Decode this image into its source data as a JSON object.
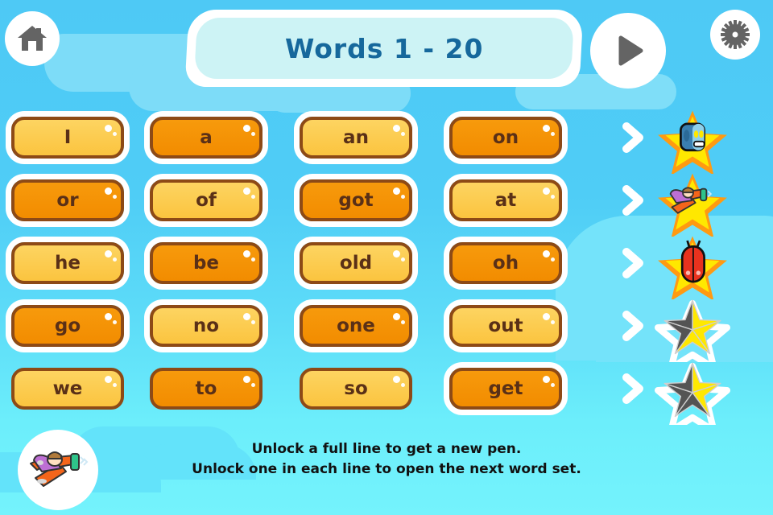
{
  "header": {
    "title": "Words  1 - 20",
    "home_icon": "home-icon",
    "play_icon": "play-icon",
    "gear_icon": "gear-icon"
  },
  "grid": {
    "rows": [
      {
        "words": [
          {
            "label": "I",
            "state": "light",
            "ring": true
          },
          {
            "label": "a",
            "state": "dark",
            "ring": true
          },
          {
            "label": "an",
            "state": "light",
            "ring": true
          },
          {
            "label": "on",
            "state": "dark",
            "ring": true
          }
        ],
        "chevron": "chevron-right-icon",
        "star": {
          "type": "unlocked",
          "pen": "robot-pen",
          "filled": 5
        }
      },
      {
        "words": [
          {
            "label": "or",
            "state": "dark",
            "ring": true
          },
          {
            "label": "of",
            "state": "light",
            "ring": true
          },
          {
            "label": "got",
            "state": "dark",
            "ring": true
          },
          {
            "label": "at",
            "state": "light",
            "ring": true
          }
        ],
        "chevron": "chevron-right-icon",
        "star": {
          "type": "unlocked",
          "pen": "plane-pen",
          "filled": 5
        }
      },
      {
        "words": [
          {
            "label": "he",
            "state": "light",
            "ring": true
          },
          {
            "label": "be",
            "state": "dark",
            "ring": true
          },
          {
            "label": "old",
            "state": "light",
            "ring": true
          },
          {
            "label": "oh",
            "state": "dark",
            "ring": true
          }
        ],
        "chevron": "chevron-right-icon",
        "star": {
          "type": "unlocked",
          "pen": "bug-pen",
          "filled": 5
        }
      },
      {
        "words": [
          {
            "label": "go",
            "state": "dark",
            "ring": true
          },
          {
            "label": "no",
            "state": "light",
            "ring": true
          },
          {
            "label": "one",
            "state": "dark",
            "ring": true
          },
          {
            "label": "out",
            "state": "light",
            "ring": true
          }
        ],
        "chevron": "chevron-right-icon",
        "star": {
          "type": "progress",
          "pen": "",
          "filled": 3
        }
      },
      {
        "words": [
          {
            "label": "we",
            "state": "light",
            "ring": false
          },
          {
            "label": "to",
            "state": "dark",
            "ring": false
          },
          {
            "label": "so",
            "state": "light",
            "ring": false
          },
          {
            "label": "get",
            "state": "dark",
            "ring": true
          }
        ],
        "chevron": "chevron-right-icon",
        "star": {
          "type": "progress",
          "pen": "",
          "filled": 2
        }
      }
    ]
  },
  "footer": {
    "line1": "Unlock a full line to get a new pen.",
    "line2": "Unlock one in each line to open the next word set.",
    "badge_icon": "plane-badge-icon"
  },
  "colors": {
    "background_top": "#4ec9f5",
    "background_bottom": "#74f3fc",
    "word_light": "#fbc43f",
    "word_dark": "#f28c00",
    "word_border": "#8d4a16",
    "word_text": "#5a3017",
    "title_text": "#16689c",
    "title_plate": "#cdf3f5",
    "star_yellow": "#ffe800",
    "star_orange": "#ff9a11",
    "star_gray": "#545454",
    "icon_gray": "#646464"
  }
}
